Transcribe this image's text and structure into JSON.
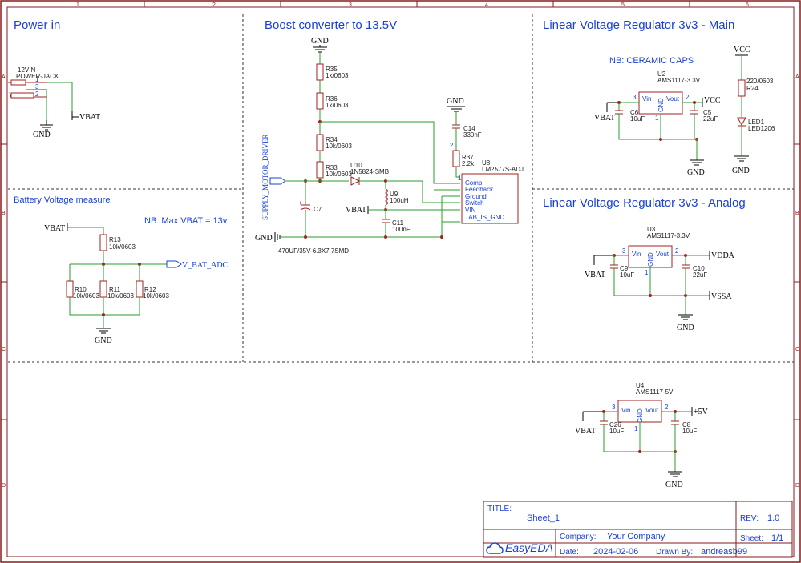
{
  "frame": {
    "cols": [
      "1",
      "2",
      "3",
      "4",
      "5",
      "6"
    ],
    "rows": [
      "A",
      "B",
      "C",
      "D"
    ]
  },
  "sections": {
    "power_in": "Power in",
    "boost": "Boost converter to 13.5V",
    "lin_main": "Linear Voltage Regulator 3v3 - Main",
    "battery": "Battery Voltage measure",
    "lin_analog": "Linear Voltage Regulator 3v3 - Analog"
  },
  "notes": {
    "ceramic": "NB: CERAMIC CAPS",
    "maxvbat": "NB: Max VBAT = 13v"
  },
  "power_in": {
    "jack_name": "12VIN",
    "jack_part": "POWER-JACK",
    "pins": [
      "1",
      "3",
      "2"
    ],
    "gnd": "GND",
    "vbat": "VBAT"
  },
  "boost": {
    "gnd_top": "GND",
    "r35": "R35",
    "r35v": "1k/0603",
    "r36": "R36",
    "r36v": "1k/0603",
    "r34": "R34",
    "r34v": "10k/0603",
    "r33": "R33",
    "r33v": "10k/0603",
    "u10": "U10",
    "u10v": "1N5824-SMB",
    "u9": "U9",
    "u9v": "100uH",
    "c11": "C11",
    "c11v": "100nF",
    "c7": "C7",
    "c7v": "470UF/35V-6.3X7.7SMD",
    "gnd_cap": "GND",
    "c14": "C14",
    "c14v": "330nF",
    "r37": "R37",
    "r37v": "2.2k",
    "u8": "U8",
    "u8v": "LM2577S-ADJ",
    "u8pins": [
      "Comp",
      "Feedback",
      "Ground",
      "Switch",
      "VIN",
      "TAB_IS_GND"
    ],
    "supply": "SUPPLY_MOTOR_DRIVER",
    "vbat": "VBAT",
    "gnd_left": "GND",
    "pin1": "1",
    "pin2": "2"
  },
  "lin_main": {
    "u2": "U2",
    "u2v": "AMS1117-3.3V",
    "vin": "Vin",
    "vout": "Vout",
    "gnd": "GND",
    "p3": "3",
    "p2": "2",
    "p1": "1",
    "c6": "C6",
    "c6v": "10uF",
    "c5": "C5",
    "c5v": "22uF",
    "vbat": "VBAT",
    "vcc_out": "VCC",
    "gnd_net": "GND",
    "vcc_top": "VCC",
    "r24": "R24",
    "r24v": "220/0603",
    "led1": "LED1",
    "led1v": "LED1206",
    "gnd_led": "GND"
  },
  "battery": {
    "vbat": "VBAT",
    "r13": "R13",
    "r13v": "10k/0603",
    "r10": "R10",
    "r10v": "10k/0603",
    "r11": "R11",
    "r11v": "10k/0603",
    "r12": "R12",
    "r12v": "10k/0603",
    "adc": "V_BAT_ADC",
    "gnd": "GND"
  },
  "lin_analog": {
    "u3": "U3",
    "u3v": "AMS1117-3.3V",
    "vin": "Vin",
    "vout": "Vout",
    "gnd": "GND",
    "p3": "3",
    "p2": "2",
    "p1": "1",
    "c9": "C9",
    "c9v": "10uF",
    "c10": "C10",
    "c10v": "22uF",
    "vbat": "VBAT",
    "vdda": "VDDA",
    "vssa": "VSSA",
    "gnd_net": "GND"
  },
  "reg5v": {
    "u4": "U4",
    "u4v": "AMS1117-5V",
    "vin": "Vin",
    "vout": "Vout",
    "gnd": "GND",
    "p3": "3",
    "p2": "2",
    "p1": "1",
    "c26": "C26",
    "c26v": "10uF",
    "c8": "C8",
    "c8v": "10uF",
    "vbat": "VBAT",
    "v5": "+5V",
    "gnd_net": "GND"
  },
  "title_block": {
    "title_label": "TITLE:",
    "title": "Sheet_1",
    "rev_label": "REV:",
    "rev": "1.0",
    "logo": "EasyEDA",
    "company_label": "Company:",
    "company": "Your Company",
    "sheet_label": "Sheet:",
    "sheet": "1/1",
    "date_label": "Date:",
    "date": "2024-02-06",
    "drawn_label": "Drawn By:",
    "drawn": "andreasb99"
  },
  "colors": {
    "wire": "#2a9e2a",
    "component": "#a32020",
    "text": "#1a3fd6"
  }
}
